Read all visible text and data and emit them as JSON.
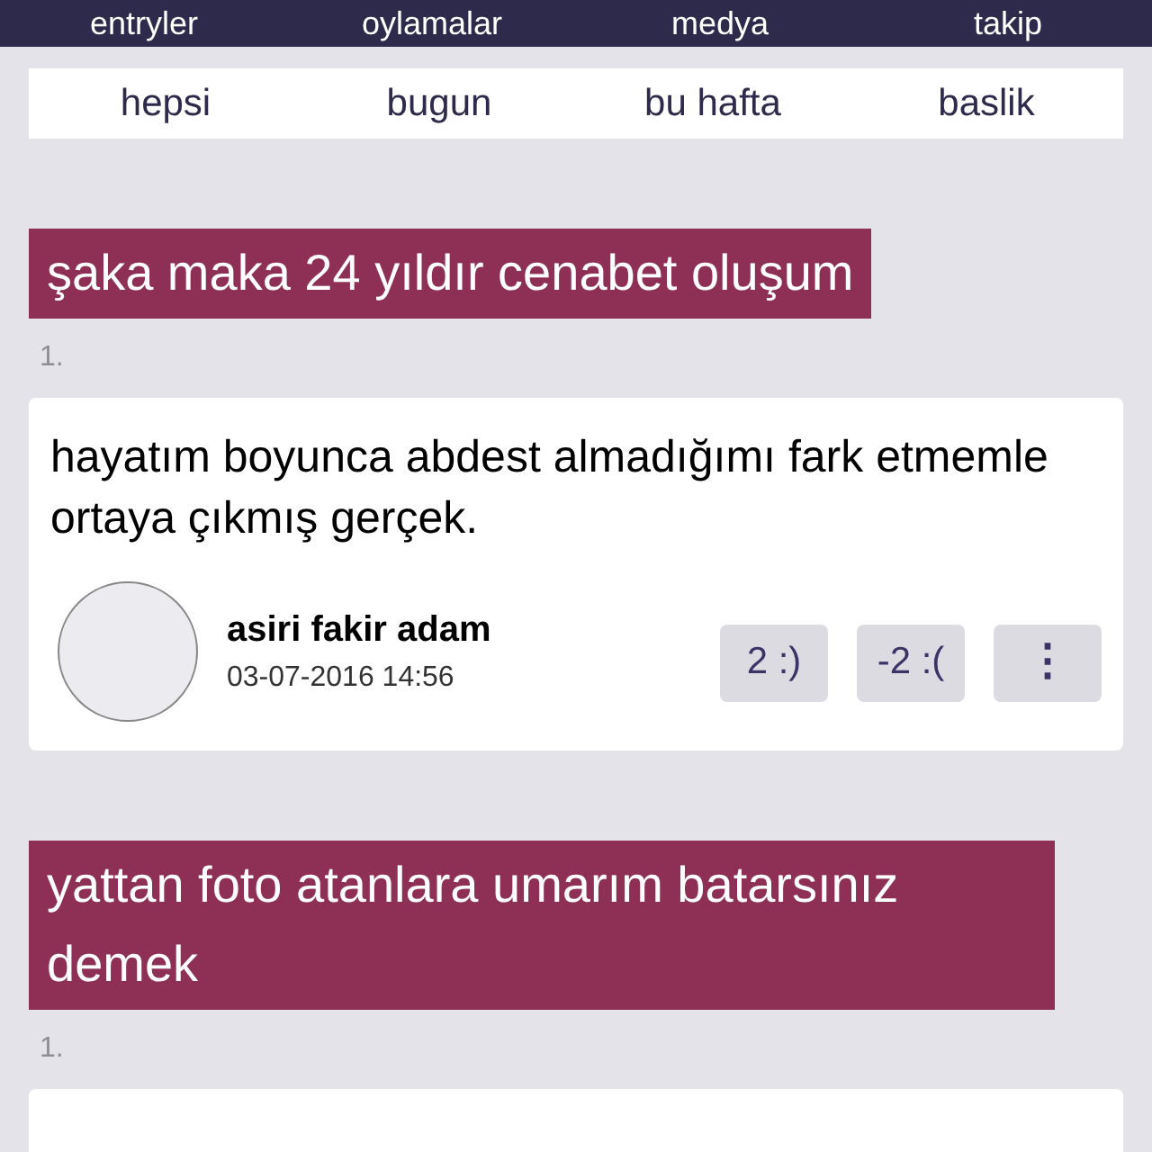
{
  "nav": [
    "entryler",
    "oylamalar",
    "medya",
    "takip"
  ],
  "filters": [
    "hepsi",
    "bugun",
    "bu hafta",
    "baslik"
  ],
  "topics": [
    {
      "title": "şaka maka 24 yıldır cenabet oluşum",
      "index": "1.",
      "entry": {
        "text": "hayatım boyunca abdest almadığımı fark etmemle ortaya çıkmış gerçek.",
        "author": "asiri fakir adam",
        "date": "03-07-2016 14:56",
        "up": "2 :)",
        "down": "-2 :(",
        "more": "⋮"
      }
    },
    {
      "title": "yattan foto atanlara umarım batarsınız demek",
      "index": "1."
    }
  ]
}
